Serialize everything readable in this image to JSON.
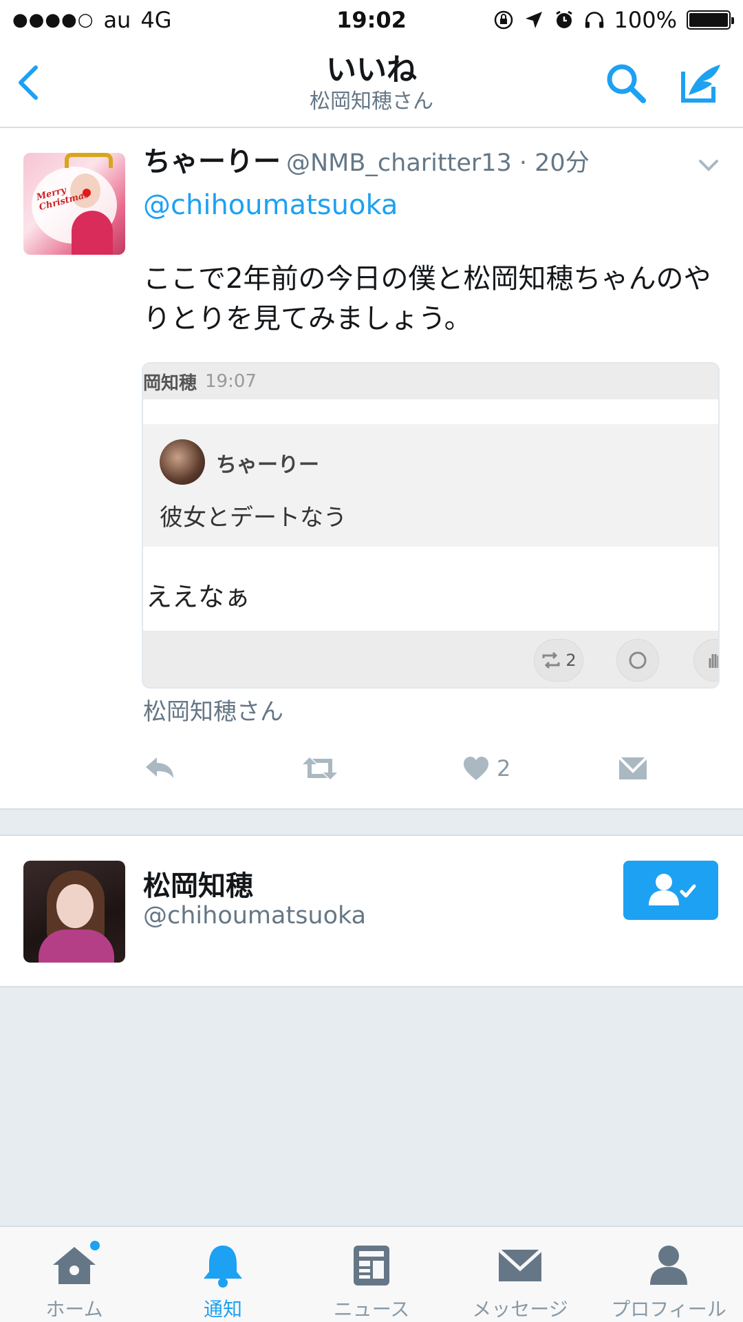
{
  "status_bar": {
    "signal": "●●●●○",
    "carrier": "au",
    "network": "4G",
    "time": "19:02",
    "battery_percent": "100%",
    "battery_level": 1.0
  },
  "nav": {
    "title": "いいね",
    "subtitle": "松岡知穂さん"
  },
  "tweet": {
    "author_name": "ちゃーりー",
    "author_handle": "@NMB_charitter13 · 20分",
    "mention": "@chihoumatsuoka",
    "text": "ここで2年前の今日の僕と松岡知穂ちゃんのやりとりを見てみましょう。",
    "embed": {
      "top_name": "岡知穂",
      "top_time": "19:07",
      "quote_name": "ちゃーりー",
      "quote_text": "彼女とデートなう",
      "reply_text": "ええなぁ",
      "retweet_count": "2"
    },
    "context": "松岡知穂さん",
    "like_count": "2"
  },
  "user_card": {
    "name": "松岡知穂",
    "handle": "@chihoumatsuoka"
  },
  "tabs": [
    {
      "label": "ホーム",
      "icon": "home-icon"
    },
    {
      "label": "通知",
      "icon": "bell-icon"
    },
    {
      "label": "ニュース",
      "icon": "news-icon"
    },
    {
      "label": "メッセージ",
      "icon": "envelope-icon"
    },
    {
      "label": "プロフィール",
      "icon": "person-icon"
    }
  ],
  "colors": {
    "accent": "#1da1f2",
    "muted": "#657786",
    "icon_gray": "#8899a6",
    "background": "#e6ecf0"
  }
}
